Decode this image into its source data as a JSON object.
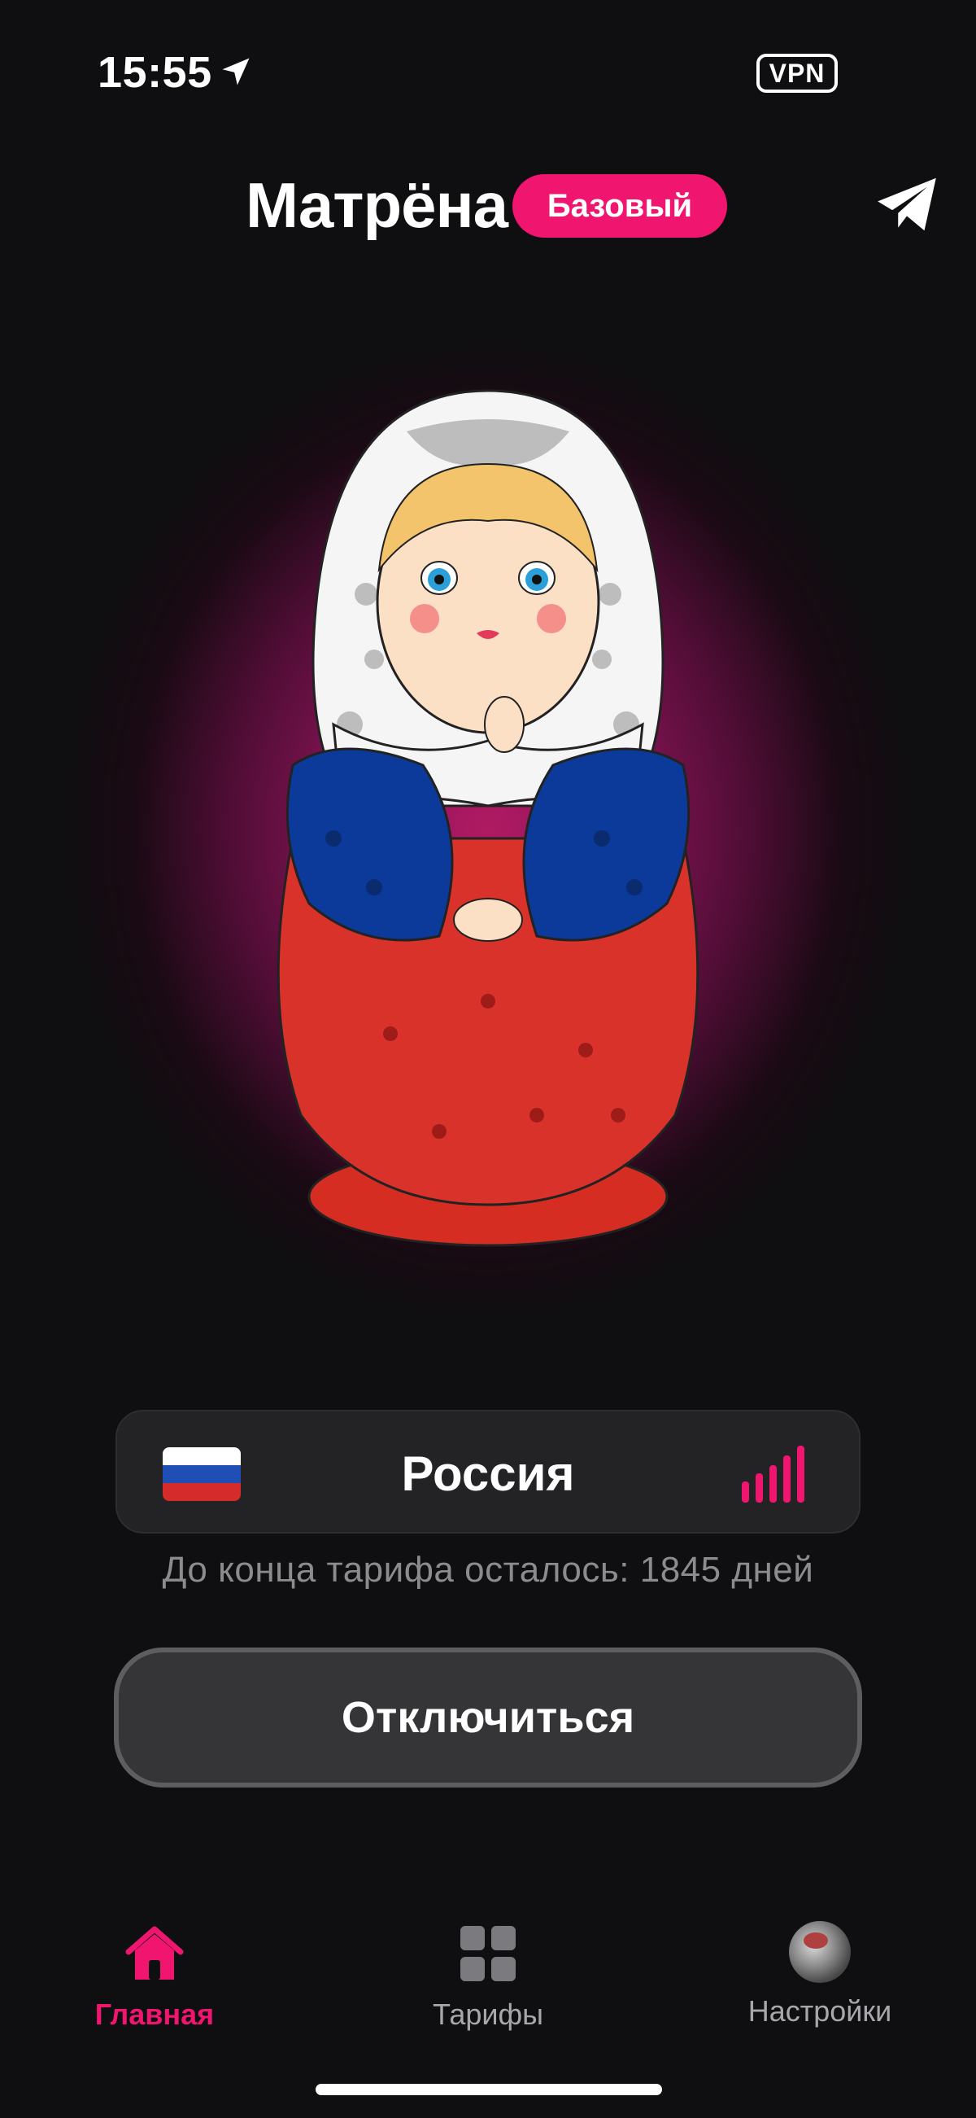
{
  "status_bar": {
    "time": "15:55",
    "vpn_label": "VPN"
  },
  "header": {
    "title": "Матрёна",
    "plan_badge": "Базовый"
  },
  "server": {
    "country": "Россия",
    "flag": "ru-flag",
    "signal_level": 1.0
  },
  "subscription": {
    "remaining_text": "До конца тарифа осталось: 1845 дней"
  },
  "actions": {
    "disconnect_label": "Отключиться"
  },
  "tabbar": {
    "items": [
      {
        "label": "Главная",
        "icon": "home-icon",
        "active": true
      },
      {
        "label": "Тарифы",
        "icon": "grid-icon",
        "active": false
      },
      {
        "label": "Настройки",
        "icon": "avatar",
        "active": false
      }
    ]
  },
  "colors": {
    "accent": "#f0166f",
    "background": "#0f0e10",
    "card": "#232224"
  }
}
